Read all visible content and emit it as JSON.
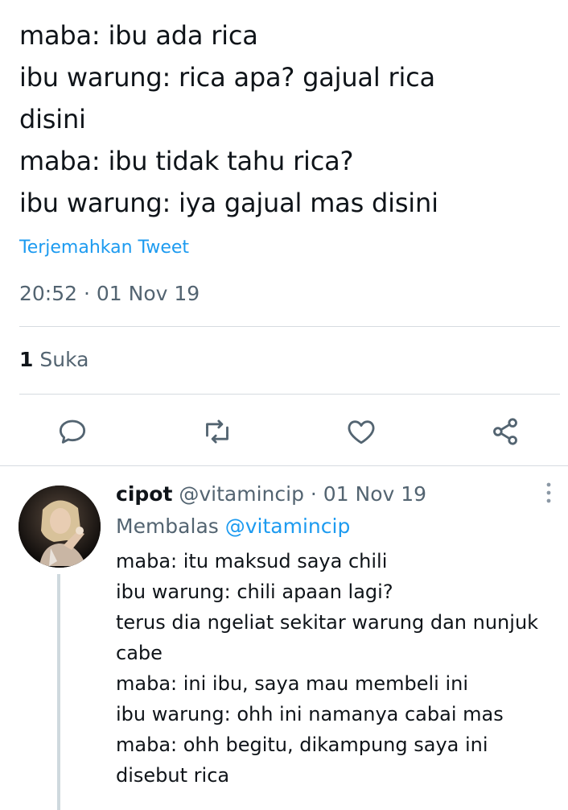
{
  "main_tweet": {
    "text_lines": [
      "maba: ibu ada rica",
      "ibu warung: rica apa? gajual rica",
      "disini",
      "maba: ibu tidak tahu rica?",
      "ibu warung: iya gajual mas disini"
    ],
    "translate_label": "Terjemahkan Tweet",
    "timestamp": "20:52 · 01 Nov 19",
    "likes_count": "1",
    "likes_label": "Suka",
    "actions": {
      "reply_icon": "reply-icon",
      "retweet_icon": "retweet-icon",
      "like_icon": "like-icon",
      "share_icon": "share-icon"
    }
  },
  "reply_tweet": {
    "display_name": "cipot",
    "meta": "@vitamincip · 01 Nov 19",
    "replying_label": "Membalas",
    "replying_to": "@vitamincip",
    "text_lines": [
      "maba: itu maksud saya chili",
      "ibu warung: chili apaan lagi?",
      "terus dia ngeliat sekitar warung dan nunjuk",
      "cabe",
      "maba: ini ibu, saya mau membeli ini",
      "ibu warung: ohh ini namanya cabai mas",
      "maba: ohh begitu, dikampung saya ini",
      "disebut rica"
    ]
  },
  "colors": {
    "text_primary": "#0f1419",
    "text_secondary": "#536471",
    "link": "#1d9bf0",
    "divider": "#d6dbe0",
    "icon": "#536471"
  }
}
